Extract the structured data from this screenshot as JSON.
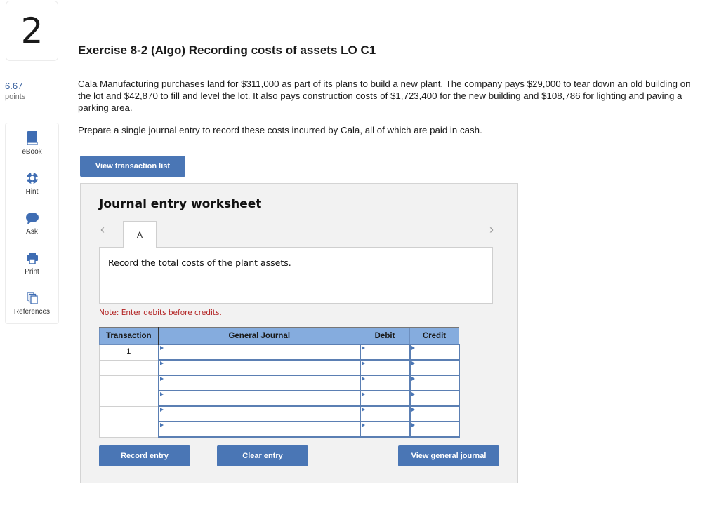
{
  "question": {
    "number": "2",
    "points_value": "6.67",
    "points_label": "points"
  },
  "tools": [
    {
      "label": "eBook",
      "icon": "book-icon"
    },
    {
      "label": "Hint",
      "icon": "lifebuoy-icon"
    },
    {
      "label": "Ask",
      "icon": "speech-bubble-icon"
    },
    {
      "label": "Print",
      "icon": "printer-icon"
    },
    {
      "label": "References",
      "icon": "documents-icon"
    }
  ],
  "exercise": {
    "title": "Exercise 8-2 (Algo) Recording costs of assets LO C1",
    "paragraph": "Cala Manufacturing purchases land for $311,000 as part of its plans to build a new plant. The company pays $29,000 to tear down an old building on the lot and $42,870 to fill and level the lot. It also pays construction costs of $1,723,400 for the new building and $108,786 for lighting and paving a parking area.",
    "instruction": "Prepare a single journal entry to record these costs incurred by Cala, all of which are paid in cash."
  },
  "buttons": {
    "view_transaction_list": "View transaction list",
    "record_entry": "Record entry",
    "clear_entry": "Clear entry",
    "view_general_journal": "View general journal"
  },
  "worksheet": {
    "title": "Journal entry worksheet",
    "prev": "‹",
    "next": "›",
    "tabs": [
      "A"
    ],
    "active_tab_instruction": "Record the total costs of the plant assets.",
    "note": "Note: Enter debits before credits.",
    "columns": [
      "Transaction",
      "General Journal",
      "Debit",
      "Credit"
    ],
    "rows": [
      {
        "transaction": "1",
        "account": "",
        "debit": "",
        "credit": ""
      },
      {
        "transaction": "",
        "account": "",
        "debit": "",
        "credit": ""
      },
      {
        "transaction": "",
        "account": "",
        "debit": "",
        "credit": ""
      },
      {
        "transaction": "",
        "account": "",
        "debit": "",
        "credit": ""
      },
      {
        "transaction": "",
        "account": "",
        "debit": "",
        "credit": ""
      },
      {
        "transaction": "",
        "account": "",
        "debit": "",
        "credit": ""
      }
    ]
  },
  "colors": {
    "accent": "#4a76b5",
    "header_blue": "#85acde",
    "note_red": "#b22222",
    "points_blue": "#2a5597"
  }
}
